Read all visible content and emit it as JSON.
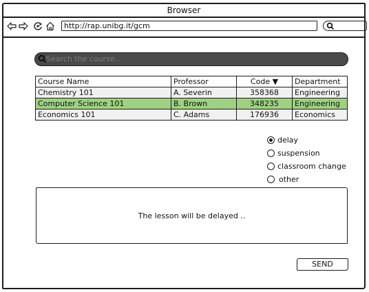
{
  "window": {
    "title": "Browser"
  },
  "toolbar": {
    "url": "http://rap.unibg.it/gcm",
    "icons": [
      "back-arrow-icon",
      "forward-arrow-icon",
      "reload-icon",
      "home-icon",
      "search-icon"
    ]
  },
  "search": {
    "placeholder": "Search the course..",
    "icon": "search-icon"
  },
  "table": {
    "columns": [
      "Course Name",
      "Professor",
      "Code",
      "Department"
    ],
    "sort_indicator": "▼",
    "rows": [
      {
        "course": "Chemistry 101",
        "professor": "A. Severin",
        "code": "358368",
        "department": "Engineering",
        "selected": false
      },
      {
        "course": "Computer Science 101",
        "professor": "B. Brown",
        "code": "348235",
        "department": "Engineering",
        "selected": true
      },
      {
        "course": "Economics 101",
        "professor": "C. Adams",
        "code": "176936",
        "department": "Economics",
        "selected": false
      }
    ],
    "selected_color": "#9fd083"
  },
  "reason": {
    "options": [
      "delay",
      "suspension",
      "classroom change",
      "other"
    ],
    "selected": "delay"
  },
  "message": {
    "text": "The lesson will be delayed .."
  },
  "send_label": "SEND"
}
